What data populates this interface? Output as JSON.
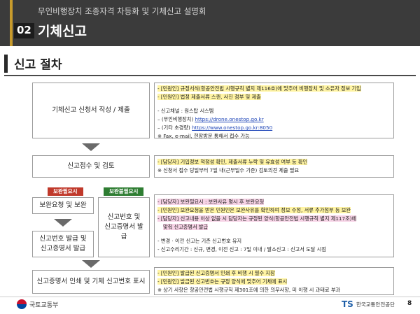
{
  "header": {
    "subtitle": "무인비행장치 조종자격 차등화 및 기체신고 설명회",
    "section_number": "02",
    "section_title": "기체신고"
  },
  "subheader": {
    "title": "신고 절차"
  },
  "steps": {
    "step1": {
      "label": "기체신고 신청서 작성 / 제출",
      "lines": [
        "- [민원인] 규정서식(항공안전법 시행규칙 별지 제116호)에 맞추어 비행장치 및 소유자 정보 기입",
        "- [민원인] 법정 제출서류 스캔, 사진 첨부 및 제출",
        "- 신고채널 : 원스탑 시스템",
        "– (무인비행장치) ",
        "https://drone.onestop.go.kr",
        "– (기타 초경량) ",
        "https://www.onestop.go.kr:8050",
        "※ Fax, e-mail, 현장방문 통해서 접수 가능"
      ]
    },
    "step2": {
      "label": "신고접수 및 검토",
      "lines": [
        "- [담당자] 기입정보 적정성 확인, 제출서류 누락 및 유효성 여부 등 확인",
        "※ 신청서 접수 당일부터 7일 내(근무일수 기준) 검토의견 제출 필요"
      ]
    },
    "step3": {
      "badge_reject": "보완필요시",
      "badge_ok": "보완불필요시",
      "supplement_box": "보완요청 및 보완",
      "issue_box": "신고번호 발급 및 신고증명서 발급",
      "issue_box_mid": "신고번호 및 신고증명서 발급",
      "lines": [
        "- [담당자] 보완필요시 : 보완사유 명시 후 보완요청",
        "- [민원인] 보완요청을 받은 민원인은 보완사유를 확인하여 정보 수정, 서류 추가첨부 등 보완",
        "- [담당자] 신고내용 이상 없을 시 담당자는 규정된 양식(항공안전법 시행규칙 별지 제117조)에",
        "맞춰 신고증명서 발급",
        "- 변경 · 이전 신고는 기존 신고번호 유지",
        "- 신고수리기간 : 신규, 변경, 이전 신고 : 7일 이내 / 말소신고 : 신고서 도달 시점"
      ]
    },
    "step4": {
      "label": "신고증명서 인쇄 및 기체 신고번호 표시",
      "lines": [
        "- [민원인] 발급된 신고증명서 인쇄 후 비행 시 필수 지참",
        "- [민원인] 발급된 신고번호는 규정 양식에 맞추어 기체에 표시",
        "※ 상기 사항은 항공안전법 시행규칙 제301조에 의한 의무사항, 미 이행 시 과태료 부과"
      ]
    }
  },
  "footer": {
    "left_logo_text": "국토교통부",
    "right_logo_mark": "TS",
    "right_logo_text": "한국교통안전공단",
    "page_number": "8"
  },
  "colors": {
    "header_bg": "#3b3b3b",
    "accent_gold": "#c89b2c",
    "highlight_yellow": "#fff4a3",
    "highlight_pink": "#f7d3e6",
    "badge_red": "#c0392b",
    "badge_green": "#2e7d32",
    "link_blue": "#1f46b8"
  }
}
